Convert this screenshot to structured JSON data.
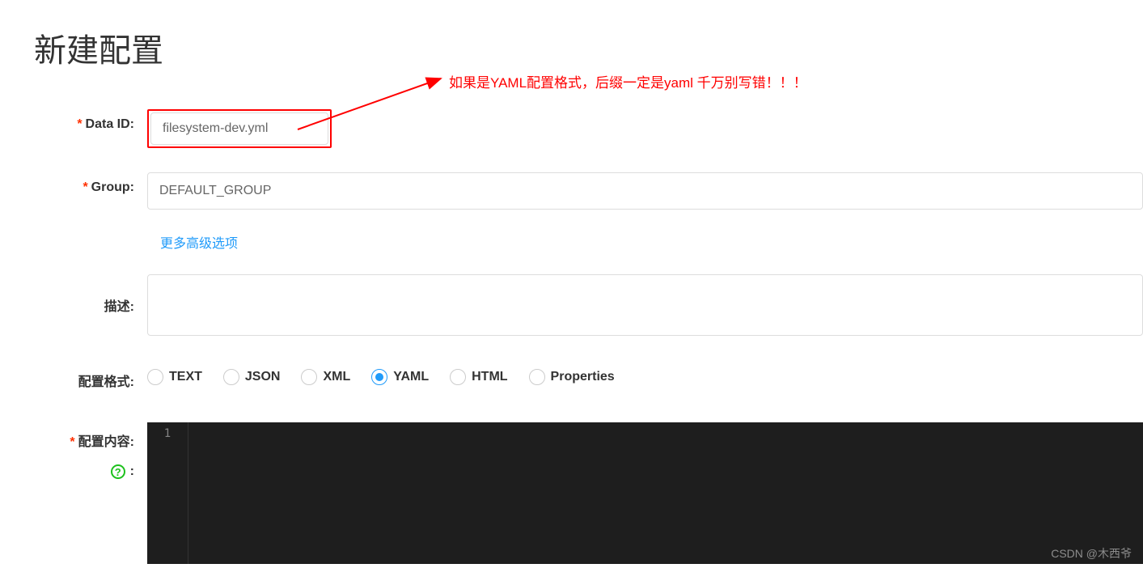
{
  "header": {
    "title": "新建配置"
  },
  "annotation": {
    "text": "如果是YAML配置格式，后缀一定是yaml  千万别写错！！！"
  },
  "form": {
    "data_id": {
      "label": "Data ID:",
      "value": "filesystem-dev.yml"
    },
    "group": {
      "label": "Group:",
      "value": "DEFAULT_GROUP"
    },
    "advanced_link": "更多高级选项",
    "description": {
      "label": "描述:",
      "value": ""
    },
    "format": {
      "label": "配置格式:",
      "options": [
        "TEXT",
        "JSON",
        "XML",
        "YAML",
        "HTML",
        "Properties"
      ],
      "selected": "YAML"
    },
    "content": {
      "label": "配置内容:",
      "line_number": "1",
      "value": ""
    }
  },
  "watermark": "CSDN @木西爷"
}
